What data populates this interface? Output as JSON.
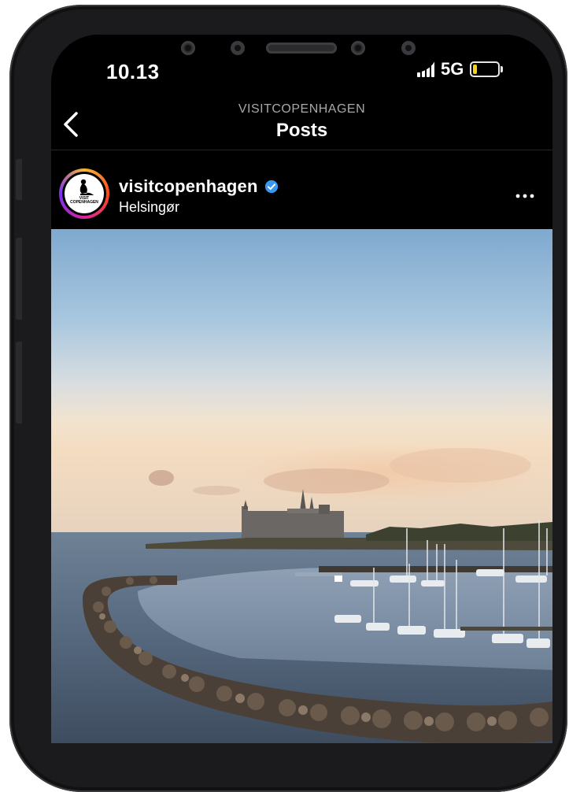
{
  "status_bar": {
    "time": "10.13",
    "network": "5G",
    "battery_level": 0.18,
    "battery_color": "#f2d21b"
  },
  "header": {
    "account_caps": "VISITCOPENHAGEN",
    "title": "Posts",
    "back_icon": "chevron-left-icon"
  },
  "post": {
    "username": "visitcopenhagen",
    "verified": true,
    "verified_color": "#3897f0",
    "location": "Helsingør",
    "avatar_text": [
      "VISIT",
      "COPENHAGEN"
    ],
    "more_icon": "more-horizontal-icon",
    "image_icon": "photo-harbor-castle"
  }
}
